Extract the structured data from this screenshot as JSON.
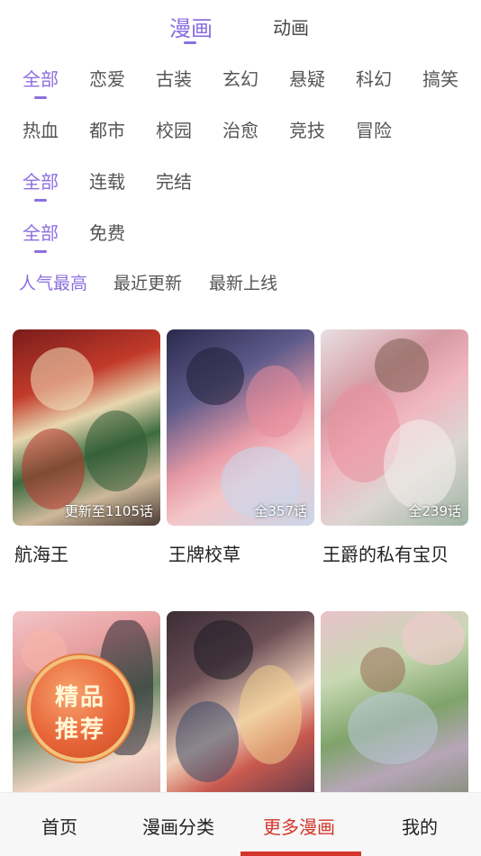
{
  "top_tabs": [
    {
      "label": "漫画",
      "active": true
    },
    {
      "label": "动画",
      "active": false
    }
  ],
  "genre_filters": [
    "全部",
    "恋爱",
    "古装",
    "玄幻",
    "悬疑",
    "科幻",
    "搞笑",
    "热血",
    "都市",
    "校园",
    "治愈",
    "竞技",
    "冒险"
  ],
  "status_filters": [
    "全部",
    "连载",
    "完结"
  ],
  "price_filters": [
    "全部",
    "免费"
  ],
  "sort_options": [
    "人气最高",
    "最近更新",
    "最新上线"
  ],
  "comics": [
    {
      "title": "航海王",
      "badge": "更新至1105话"
    },
    {
      "title": "王牌校草",
      "badge": "全357话"
    },
    {
      "title": "王爵的私有宝贝",
      "badge": "全239话"
    },
    {
      "title": "",
      "badge": ""
    },
    {
      "title": "",
      "badge": ""
    },
    {
      "title": "",
      "badge": ""
    }
  ],
  "promo_badge": {
    "line1": "精品",
    "line2": "推荐"
  },
  "bottom_nav": [
    {
      "label": "首页",
      "active": false
    },
    {
      "label": "漫画分类",
      "active": false
    },
    {
      "label": "更多漫画",
      "active": true
    },
    {
      "label": "我的",
      "active": false
    }
  ],
  "colors": {
    "accent": "#8b6fe0",
    "nav_active": "#d4362c"
  }
}
